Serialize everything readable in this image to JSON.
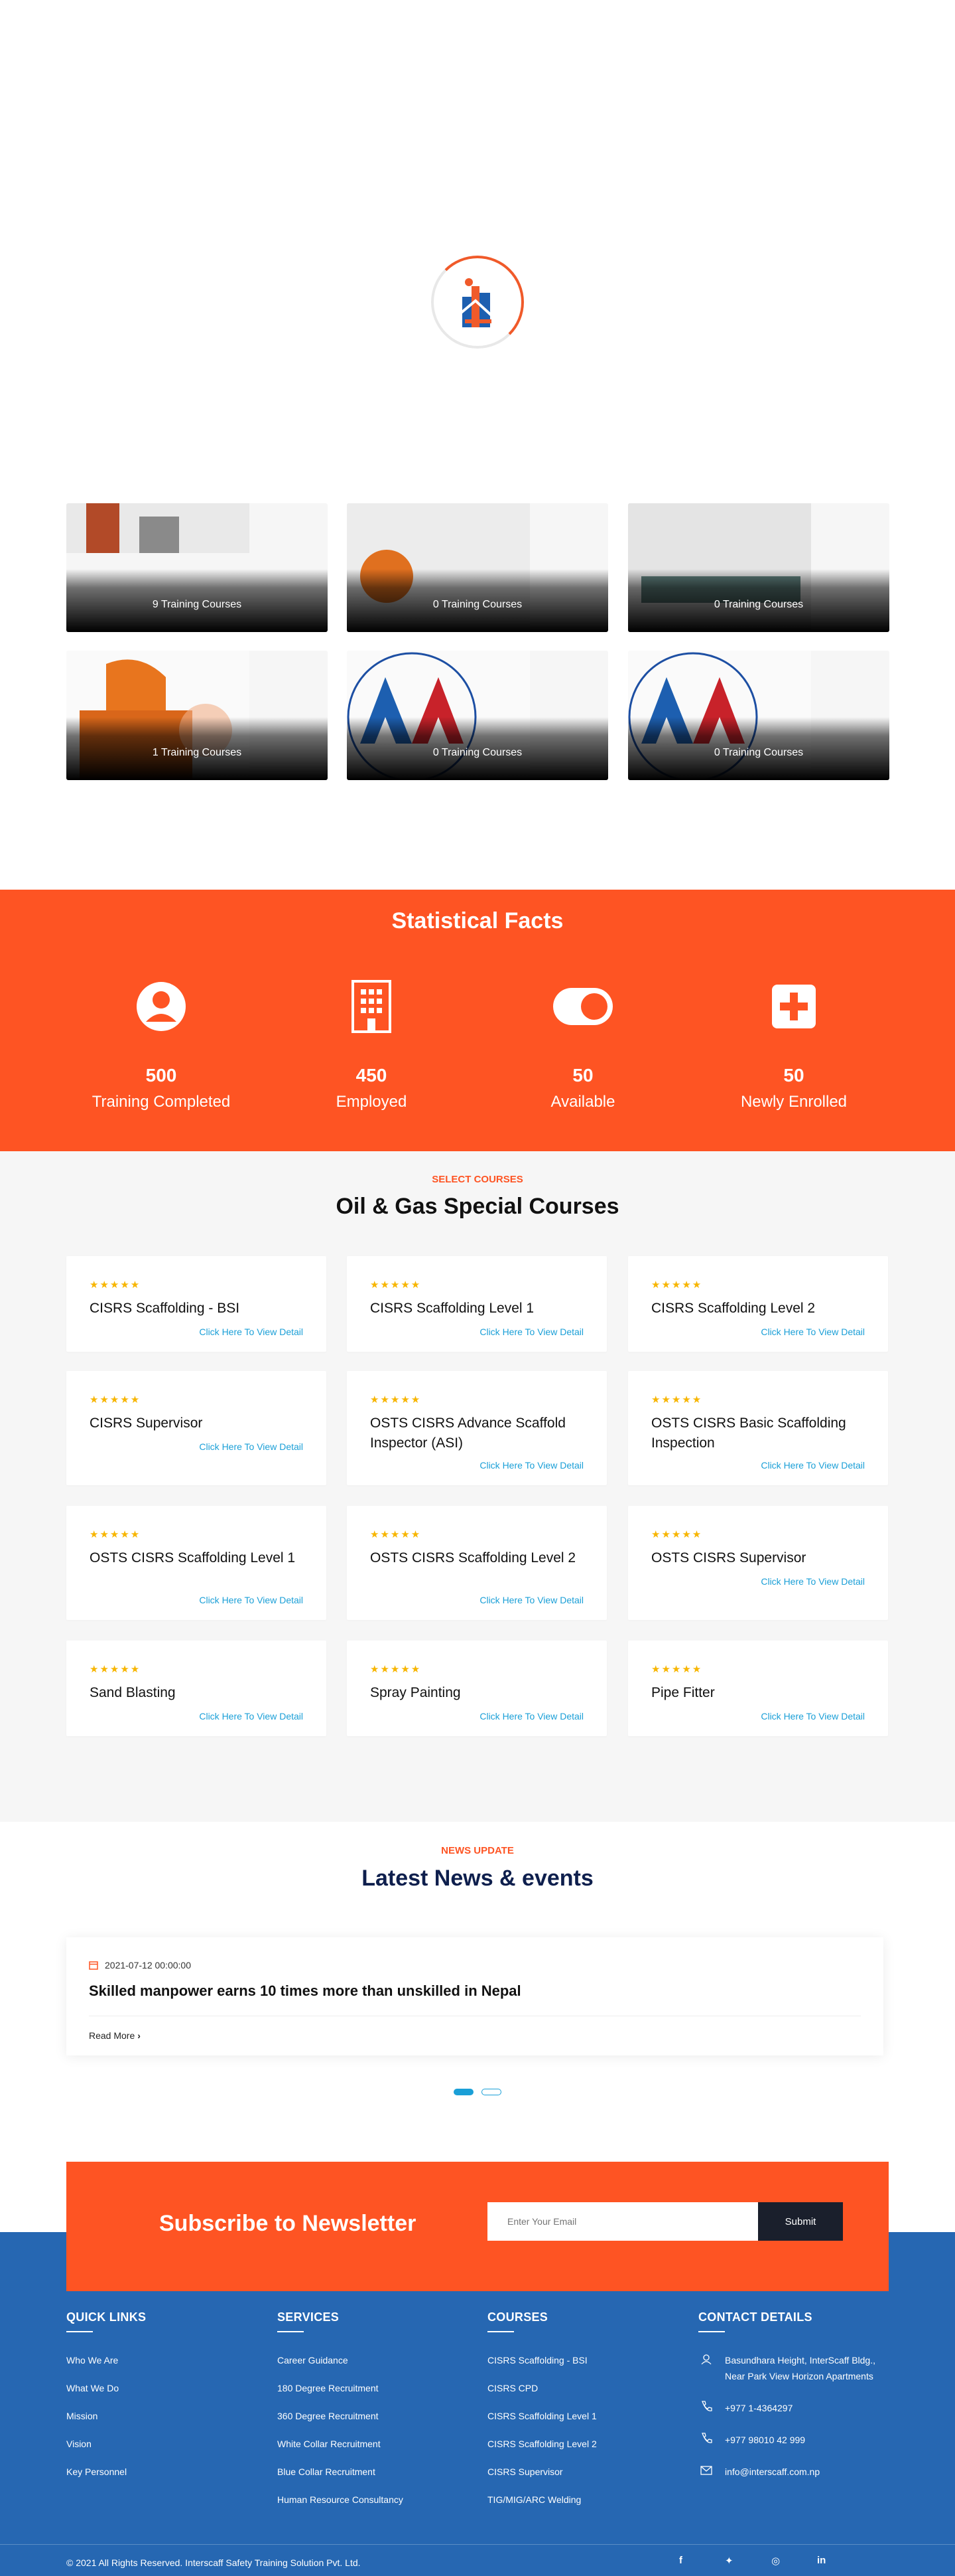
{
  "categories": [
    {
      "count": "9 Training Courses"
    },
    {
      "count": "0 Training Courses"
    },
    {
      "count": "0 Training Courses"
    },
    {
      "count": "1 Training Courses"
    },
    {
      "count": "0 Training Courses"
    },
    {
      "count": "0 Training Courses"
    }
  ],
  "stats": {
    "title": "Statistical Facts",
    "items": [
      {
        "value": "500",
        "label": "Training Completed"
      },
      {
        "value": "450",
        "label": "Employed"
      },
      {
        "value": "50",
        "label": "Available"
      },
      {
        "value": "50",
        "label": "Newly Enrolled"
      }
    ]
  },
  "courses": {
    "eyebrow": "SELECT COURSES",
    "title": "Oil & Gas Special Courses",
    "link_label": "Click Here To View Detail",
    "items": [
      {
        "name": "CISRS Scaffolding - BSI",
        "stars": "★★★★★"
      },
      {
        "name": "CISRS Scaffolding Level 1",
        "stars": "★★★★★"
      },
      {
        "name": "CISRS Scaffolding Level 2",
        "stars": "★★★★★"
      },
      {
        "name": "CISRS Supervisor",
        "stars": "★★★★★"
      },
      {
        "name": "OSTS CISRS Advance Scaffold Inspector (ASI)",
        "stars": "★★★★★"
      },
      {
        "name": "OSTS CISRS Basic Scaffolding Inspection",
        "stars": "★★★★★"
      },
      {
        "name": "OSTS CISRS Scaffolding Level 1",
        "stars": "★★★★★"
      },
      {
        "name": "OSTS CISRS Scaffolding Level 2",
        "stars": "★★★★★"
      },
      {
        "name": "OSTS CISRS Supervisor",
        "stars": "★★★★★"
      },
      {
        "name": "Sand Blasting",
        "stars": "★★★★★"
      },
      {
        "name": "Spray Painting",
        "stars": "★★★★★"
      },
      {
        "name": "Pipe Fitter",
        "stars": "★★★★★"
      }
    ]
  },
  "news": {
    "eyebrow": "NEWS UPDATE",
    "title": "Latest News & events",
    "date": "2021-07-12 00:00:00",
    "headline": "Skilled manpower earns 10 times more than unskilled in Nepal",
    "read_more": "Read More"
  },
  "newsletter": {
    "title": "Subscribe to Newsletter",
    "placeholder": "Enter Your Email",
    "button": "Submit"
  },
  "footer": {
    "quick_links": {
      "title": "QUICK LINKS",
      "items": [
        "Who We Are",
        "What We Do",
        "Mission",
        "Vision",
        "Key Personnel"
      ]
    },
    "services": {
      "title": "SERVICES",
      "items": [
        "Career Guidance",
        "180 Degree Recruitment",
        "360 Degree Recruitment",
        "White Collar Recruitment",
        "Blue Collar Recruitment",
        "Human Resource Consultancy"
      ]
    },
    "courses": {
      "title": "COURSES",
      "items": [
        "CISRS Scaffolding - BSI",
        "CISRS CPD",
        "CISRS Scaffolding Level 1",
        "CISRS Scaffolding Level 2",
        "CISRS Supervisor",
        "TIG/MIG/ARC Welding"
      ]
    },
    "contact": {
      "title": "CONTACT DETAILS",
      "address_line1": "Basundhara Height, InterScaff Bldg.,",
      "address_line2": "Near Park View Horizon Apartments",
      "phone": "+977 1-4364297",
      "mobile": "+977 98010 42 999",
      "email": "info@interscaff.com.np"
    },
    "copyright": "© 2021 All Rights Reserved. Interscaff Safety Training Solution Pvt. Ltd.",
    "social": {
      "facebook": "f",
      "twitter": "✦",
      "instagram": "◎",
      "linkedin": "in"
    }
  },
  "colors": {
    "brand_orange": "#fe5423",
    "footer_blue": "#2667b2",
    "navy": "#0e1f4d",
    "link_blue": "#1a9fd7",
    "star": "#f7b500"
  }
}
